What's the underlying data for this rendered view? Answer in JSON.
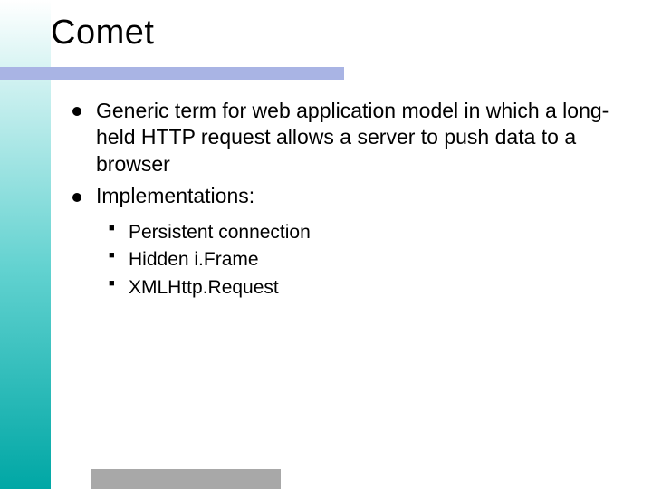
{
  "title": "Comet",
  "bullets": [
    {
      "text": "Generic term for web application model in which a long-held HTTP request allows a server to push data to a browser",
      "children": []
    },
    {
      "text": "Implementations:",
      "children": [
        "Persistent connection",
        "Hidden i.Frame",
        "XMLHttp.Request"
      ]
    }
  ]
}
